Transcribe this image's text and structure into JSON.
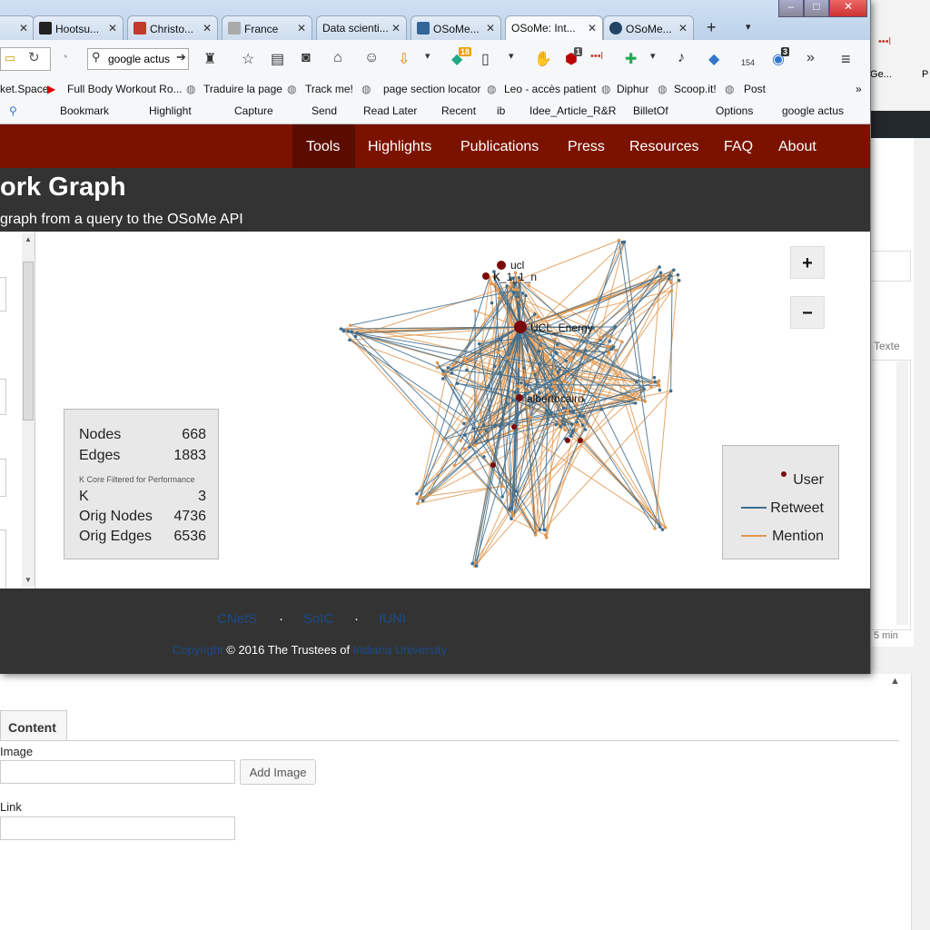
{
  "browser": {
    "tabs": [
      {
        "label": "Hootsu...",
        "icon_color": "#222222"
      },
      {
        "label": "Christo...",
        "icon_color": "#c0392b"
      },
      {
        "label": "France",
        "icon_color": "#888888"
      },
      {
        "label": "Data scienti...",
        "icon_color": "#ffffff"
      },
      {
        "label": "OSoMe...",
        "icon_color": "#336699"
      },
      {
        "label": "OSoMe: Int...",
        "icon_color": "#ffffff"
      },
      {
        "label": "OSoMe...",
        "icon_color": "#224466"
      }
    ],
    "new_tab": "+",
    "search_value": "google actus",
    "badge_18": "18",
    "badge_1": "1",
    "badge_154": "154",
    "badge_3": "3",
    "bookmarks_row1": [
      "ket.Space",
      "Full Body Workout Ro...",
      "Traduire la page",
      "Track me!",
      "page section locator",
      "Leo - accès patient",
      "Diphur",
      "Scoop.it!",
      "Post"
    ],
    "bookmarks_row2": [
      "Bookmark",
      "Highlight",
      "Capture",
      "Send",
      "Read Later",
      "Recent",
      "ib",
      "Idee_Article_R&R",
      "BilletOf",
      "Options",
      "google actus"
    ]
  },
  "site": {
    "nav": [
      "Tools",
      "Highlights",
      "Publications",
      "Press",
      "Resources",
      "FAQ",
      "About"
    ],
    "title": "ork Graph",
    "subtitle": "graph from a query to the OSoMe API"
  },
  "graph": {
    "zoom_in": "+",
    "zoom_out": "−",
    "node_labels": [
      "ucl",
      "K_1_1_n",
      "UCL_Energy",
      "albertocairo"
    ],
    "colors": {
      "user": "#7a0a0a",
      "retweet": "#3e6d8e",
      "mention": "#e0964f"
    }
  },
  "stats": {
    "nodes_label": "Nodes",
    "nodes_value": "668",
    "edges_label": "Edges",
    "edges_value": "1883",
    "note": "K Core Filtered for Performance",
    "k_label": "K",
    "k_value": "3",
    "orig_nodes_label": "Orig Nodes",
    "orig_nodes_value": "4736",
    "orig_edges_label": "Orig Edges",
    "orig_edges_value": "6536"
  },
  "legend": {
    "user": "User",
    "retweet": "Retweet",
    "mention": "Mention"
  },
  "footer": {
    "links": [
      "CNetS",
      "SoIC",
      "IUNI"
    ],
    "dot": "·",
    "copyright_link": "Copyright",
    "copyright_text": "© 2016 The Trustees of",
    "university": "Indiana University"
  },
  "background": {
    "tab": "Content",
    "image_label": "Image",
    "add_image": "Add Image",
    "link_label": "Link",
    "texte": "Texte",
    "min": "5 min",
    "right_frag1": "tGe...",
    "right_frag2": "P"
  }
}
